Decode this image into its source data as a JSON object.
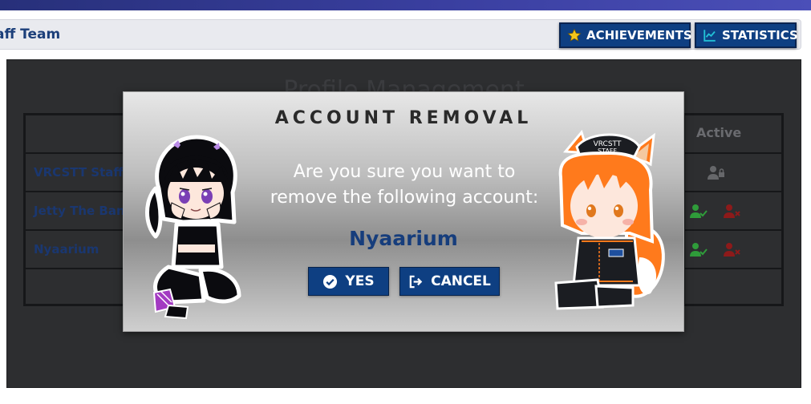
{
  "header": {
    "team_title": "aff Team",
    "achievements_label": "ACHIEVEMENTS",
    "statistics_label": "STATISTICS"
  },
  "panel": {
    "title": "Profile Management",
    "active_header": "Active",
    "rows": [
      {
        "name": "VRCSTT Staff T"
      },
      {
        "name": "Jetty The Band"
      },
      {
        "name": "Nyaarium"
      }
    ]
  },
  "modal": {
    "title": "ACCOUNT REMOVAL",
    "question_line1": "Are you sure you want to",
    "question_line2": "remove the following account:",
    "account_name": "Nyaarium",
    "yes_label": "YES",
    "cancel_label": "CANCEL",
    "hat_text_1": "VRCSTT",
    "hat_text_2": "STAFF"
  },
  "colors": {
    "primary": "#0e3f82",
    "name_text": "#1a3770",
    "accent_yellow": "#f2c51c",
    "accent_cyan": "#22c1d6",
    "role_green": "#2f9c3a",
    "role_red": "#8d1a1a"
  },
  "icons": [
    "star-icon",
    "chart-line-icon",
    "check-circle-icon",
    "sign-out-icon",
    "user-lock-icon",
    "user-check-icon",
    "user-remove-icon"
  ]
}
